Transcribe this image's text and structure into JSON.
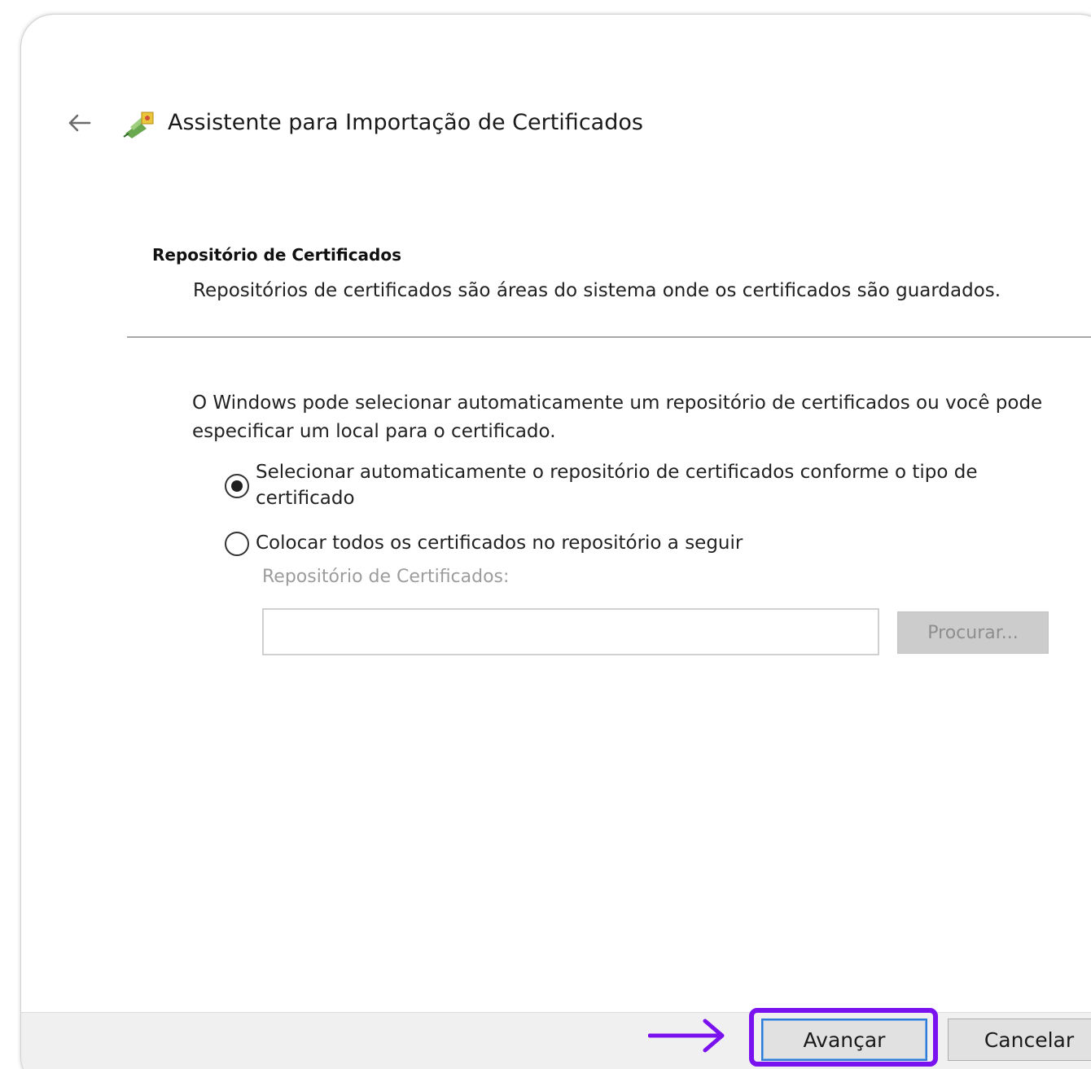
{
  "wizard": {
    "title": "Assistente para Importação de Certificados",
    "icons": {
      "back": "back-arrow-icon",
      "app": "certificate-wizard-icon"
    }
  },
  "section": {
    "title": "Repositório de Certificados",
    "description": "Repositórios de certificados são áreas do sistema onde os certificados são guardados."
  },
  "body": {
    "info": "O Windows pode selecionar automaticamente um repositório de certificados ou você pode especificar um local para o certificado.",
    "options": [
      {
        "label": "Selecionar automaticamente o repositório de certificados conforme o tipo de certificado",
        "checked": true
      },
      {
        "label": "Colocar todos os certificados no repositório a seguir",
        "checked": false
      }
    ],
    "store_label": "Repositório de Certificados:",
    "store_value": "",
    "browse_label": "Procurar..."
  },
  "footer": {
    "next_label": "Avançar",
    "cancel_label": "Cancelar"
  },
  "annotation": {
    "color": "#7a12f0",
    "icon": "right-arrow-icon"
  }
}
